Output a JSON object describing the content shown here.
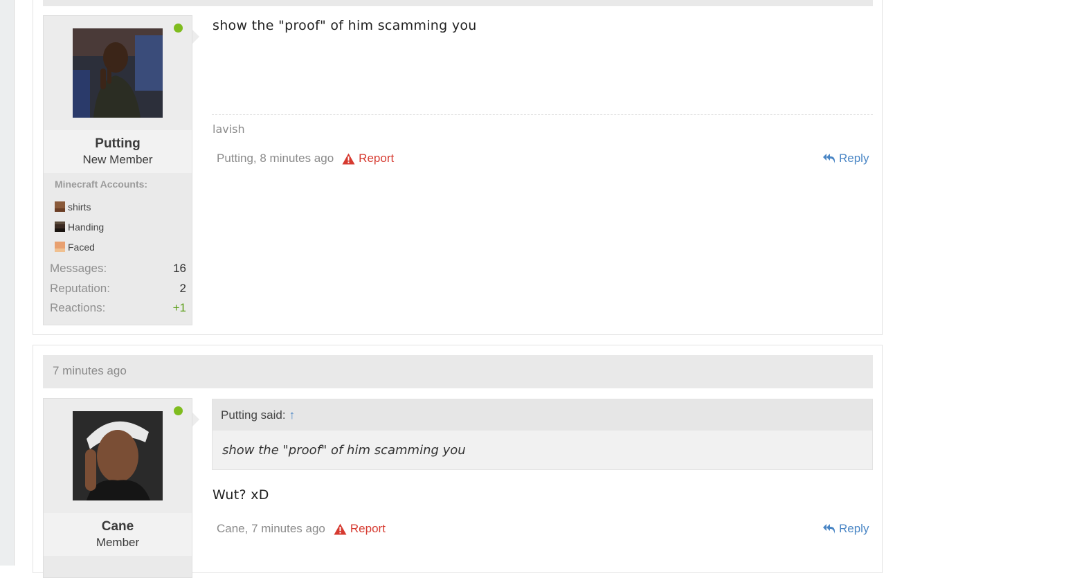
{
  "posts": [
    {
      "user": {
        "name": "Putting",
        "title": "New Member",
        "online": true,
        "minecraft_heading": "Minecraft Accounts:",
        "minecraft_accounts": [
          {
            "name": "shirts",
            "head_color": "#8a5a3a"
          },
          {
            "name": "Handing",
            "head_color": "#3a2a22"
          },
          {
            "name": "Faced",
            "head_color": "#e8a070"
          }
        ],
        "stats": [
          {
            "label": "Messages:",
            "value": "16"
          },
          {
            "label": "Reputation:",
            "value": "2"
          },
          {
            "label": "Reactions:",
            "value": "+1"
          }
        ]
      },
      "message": "show the \"proof\" of him scamming you",
      "signature": "lavish",
      "meta": "Putting, 8 minutes ago",
      "report_label": "Report",
      "reply_label": "Reply"
    },
    {
      "timestamp": "7 minutes ago",
      "user": {
        "name": "Cane",
        "title": "Member",
        "online": true
      },
      "quote": {
        "author": "Putting said:",
        "jump_icon": "↑",
        "text": "show the \"proof\" of him scamming you"
      },
      "message": "Wut? xD",
      "meta": "Cane, 7 minutes ago",
      "report_label": "Report",
      "reply_label": "Reply"
    }
  ],
  "colors": {
    "online": "#7fbc1e",
    "report": "#d63a30",
    "link": "#4a86c5",
    "positive": "#5a9e17"
  }
}
